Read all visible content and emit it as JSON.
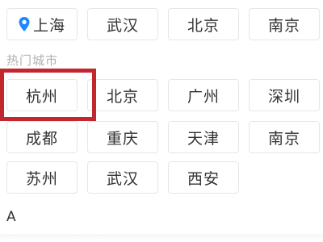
{
  "location": {
    "current_city": "上海",
    "icon": "location-pin-icon"
  },
  "recent_cities": [
    "武汉",
    "北京",
    "南京"
  ],
  "hot_cities": {
    "title": "热门城市",
    "rows": [
      [
        "杭州",
        "北京",
        "广州",
        "深圳"
      ],
      [
        "成都",
        "重庆",
        "天津",
        "南京"
      ],
      [
        "苏州",
        "武汉",
        "西安"
      ]
    ]
  },
  "index_letter": "A",
  "colors": {
    "accent": "#1e88ff",
    "highlight": "#c1272d",
    "chip_border": "#e6e6e6",
    "muted_text": "#b0b0b0"
  }
}
